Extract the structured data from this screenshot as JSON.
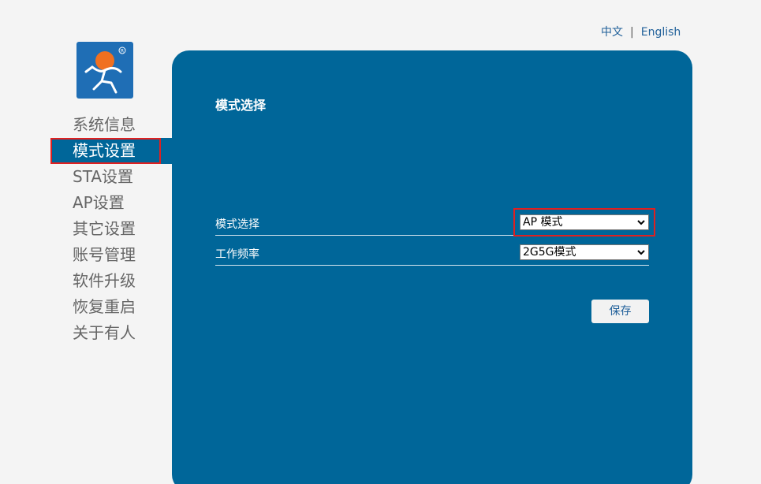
{
  "lang": {
    "chinese": "中文",
    "separator": "|",
    "english": "English"
  },
  "logo": {
    "icon": "person-logo-icon"
  },
  "sidebar": {
    "items": [
      {
        "label": "系统信息"
      },
      {
        "label": "模式设置",
        "active": true
      },
      {
        "label": "STA设置"
      },
      {
        "label": "AP设置"
      },
      {
        "label": "其它设置"
      },
      {
        "label": "账号管理"
      },
      {
        "label": "软件升级"
      },
      {
        "label": "恢复重启"
      },
      {
        "label": "关于有人"
      }
    ]
  },
  "main": {
    "title": "模式选择",
    "fields": [
      {
        "label": "模式选择",
        "value": "AP 模式"
      },
      {
        "label": "工作频率",
        "value": "2G5G模式"
      }
    ],
    "save_label": "保存"
  },
  "colors": {
    "panel": "#006699",
    "highlight": "#e02020",
    "link": "#1f5f99"
  }
}
